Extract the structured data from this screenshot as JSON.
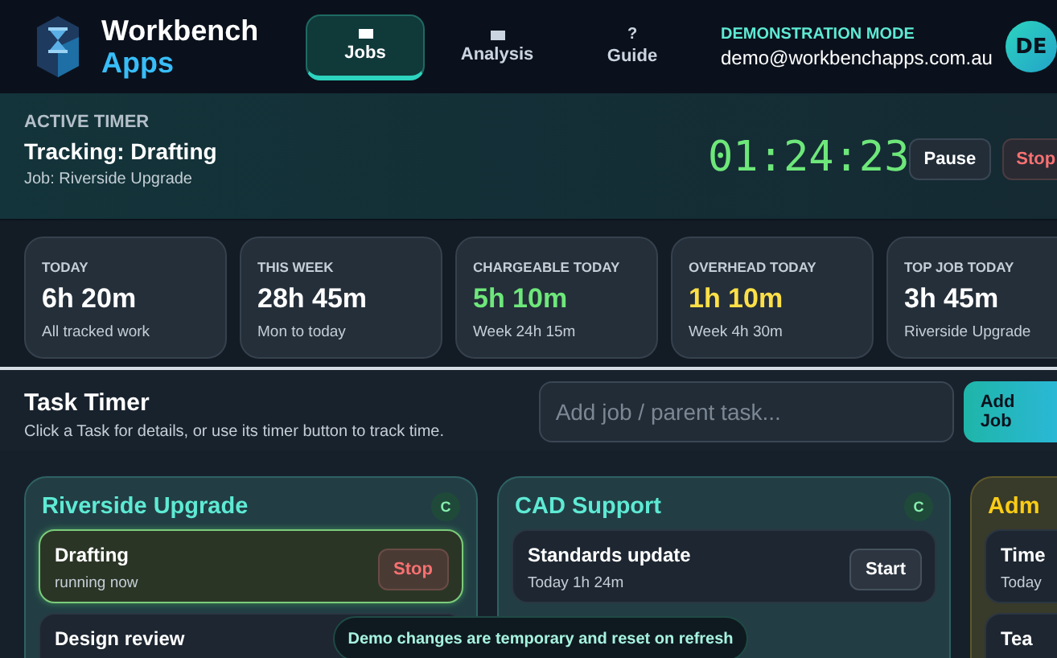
{
  "header": {
    "brand": {
      "line1": "Workbench",
      "line2": "Apps"
    },
    "tabs": [
      {
        "label": "Jobs",
        "kind": "box",
        "selected": true
      },
      {
        "label": "Analysis",
        "kind": "box",
        "selected": false
      },
      {
        "label": "Guide",
        "kind": "glyph",
        "glyph": "?",
        "selected": false
      }
    ],
    "account": {
      "mode": "DEMONSTRATION MODE",
      "email": "demo@workbenchapps.com.au",
      "initials": "DE"
    }
  },
  "active_timer": {
    "heading": "ACTIVE TIMER",
    "tracking": "Tracking: Drafting",
    "job": "Job: Riverside Upgrade",
    "elapsed": "01:24:23",
    "buttons": [
      {
        "label": "Pause",
        "kind": "neutral"
      },
      {
        "label": "Stop",
        "kind": "danger"
      }
    ]
  },
  "stats": [
    {
      "label": "TODAY",
      "value": "6h 20m",
      "note": "All tracked work",
      "color": "#ffffff"
    },
    {
      "label": "THIS WEEK",
      "value": "28h 45m",
      "note": "Mon to today",
      "color": "#ffffff"
    },
    {
      "label": "CHARGEABLE TODAY",
      "value": "5h 10m",
      "note": "Week 24h 15m",
      "color": "#6ee77a"
    },
    {
      "label": "OVERHEAD TODAY",
      "value": "1h 10m",
      "note": "Week 4h 30m",
      "color": "#fde047"
    },
    {
      "label": "TOP JOB TODAY",
      "value": "3h 45m",
      "note": "Riverside Upgrade",
      "color": "#ffffff"
    }
  ],
  "task_timer": {
    "title": "Task Timer",
    "hint": "Click a Task for details, or use its timer button to track time.",
    "search": {
      "placeholder": "Add job / parent task..."
    },
    "add_button": "Add Job"
  },
  "jobs": [
    {
      "name": "Riverside Upgrade",
      "badge": "C",
      "color": "#5eead4",
      "tasks": [
        {
          "name": "Drafting",
          "detail": "running now",
          "running": true,
          "action": "Stop"
        },
        {
          "name": "Design review",
          "running": false
        }
      ]
    },
    {
      "name": "CAD Support",
      "badge": "C",
      "color": "#5eead4",
      "tasks": [
        {
          "name": "Standards update",
          "detail": "Today 1h 24m",
          "running": false,
          "action": "Start"
        }
      ]
    },
    {
      "name": "Adm",
      "color": "#facc15",
      "tasks": [
        {
          "name": "Time",
          "detail": "Today",
          "running": false
        },
        {
          "name": "Tea",
          "running": false
        }
      ]
    }
  ],
  "toast": "Demo changes are temporary and reset on refresh"
}
